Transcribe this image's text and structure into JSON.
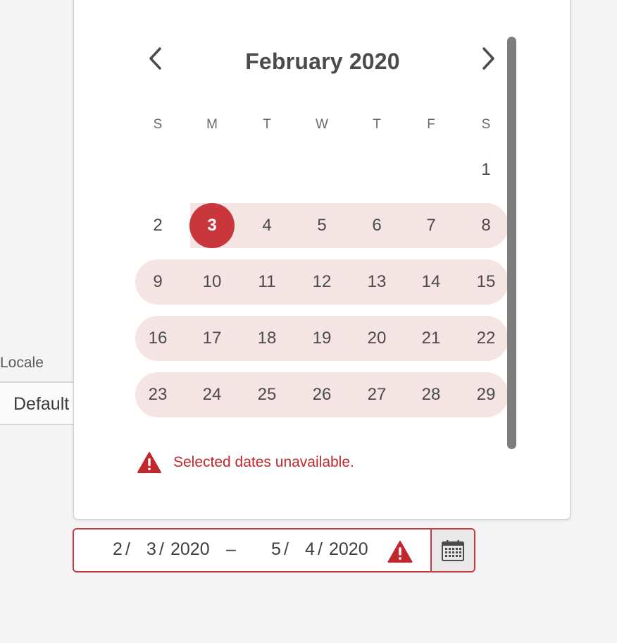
{
  "locale": {
    "label": "Locale",
    "value": "Default"
  },
  "calendar": {
    "month_title": "February 2020",
    "weekdays": [
      "S",
      "M",
      "T",
      "W",
      "T",
      "F",
      "S"
    ],
    "days": [
      "1",
      "2",
      "3",
      "4",
      "5",
      "6",
      "7",
      "8",
      "9",
      "10",
      "11",
      "12",
      "13",
      "14",
      "15",
      "16",
      "17",
      "18",
      "19",
      "20",
      "21",
      "22",
      "23",
      "24",
      "25",
      "26",
      "27",
      "28",
      "29"
    ],
    "selected_day": "3",
    "range_color": "#f5e4e4",
    "selected_color": "#c9373c"
  },
  "error": {
    "message": "Selected dates unavailable.",
    "color": "#c0282e"
  },
  "range_field": {
    "start_month": "2",
    "start_day": "3",
    "start_year": "2020",
    "separator": "–",
    "end_month": "5",
    "end_day": "4",
    "end_year": "2020",
    "slash": "/",
    "border_color": "#c43a3f"
  },
  "icons": {
    "prev": "chevron-left-icon",
    "next": "chevron-right-icon",
    "alert": "alert-triangle-icon",
    "calendar": "calendar-icon"
  }
}
